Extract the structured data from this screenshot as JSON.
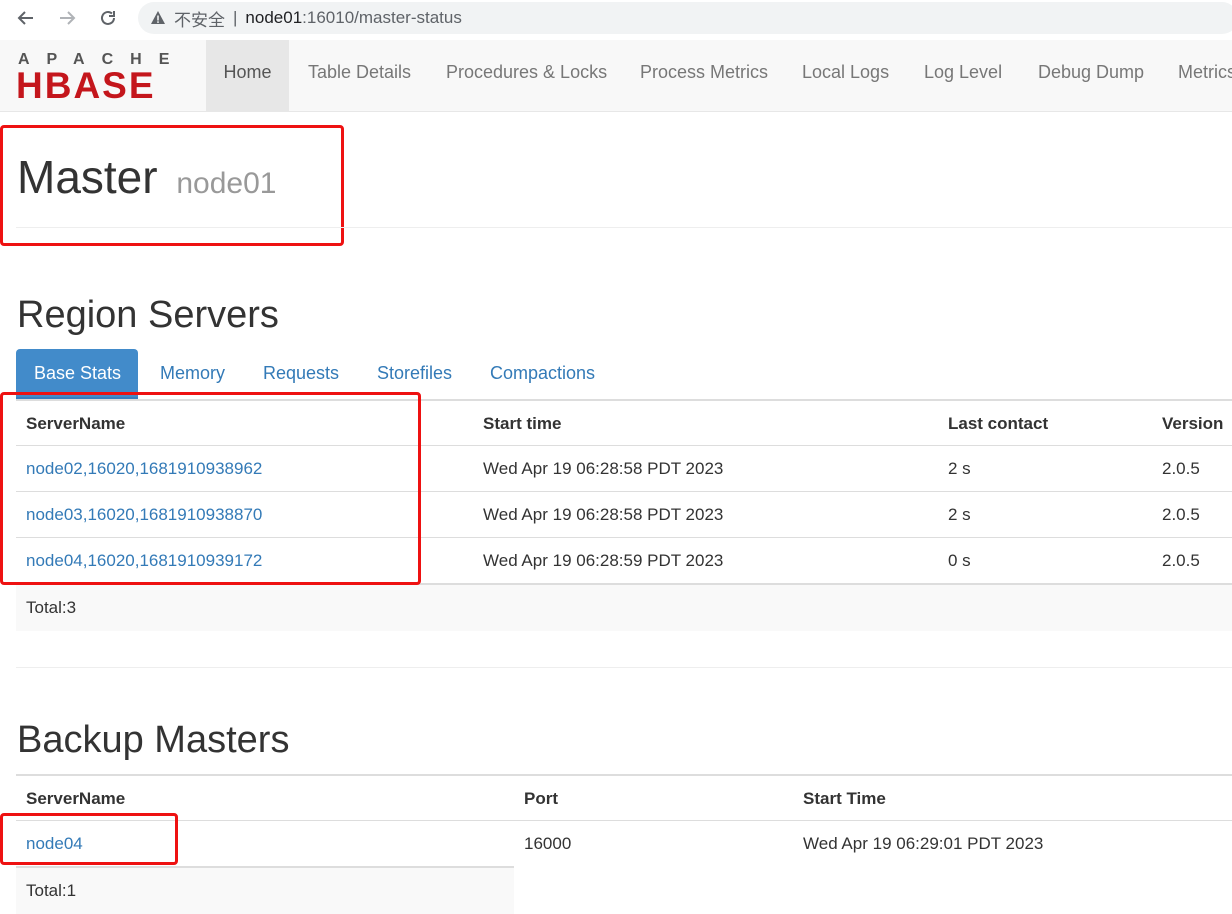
{
  "browser": {
    "back_icon": "arrow-left-icon",
    "forward_icon": "arrow-right-icon",
    "reload_icon": "reload-icon",
    "security_label": "不安全",
    "separator": "|",
    "url_host": "node01",
    "url_path": ":16010/master-status"
  },
  "navbar": {
    "logo_top": "APACHE",
    "logo_main": "HBASE",
    "items": [
      {
        "label": "Home"
      },
      {
        "label": "Table Details"
      },
      {
        "label": "Procedures & Locks"
      },
      {
        "label": "Process Metrics"
      },
      {
        "label": "Local Logs"
      },
      {
        "label": "Log Level"
      },
      {
        "label": "Debug Dump"
      },
      {
        "label": "Metrics"
      }
    ]
  },
  "page": {
    "title": "Master",
    "host": "node01"
  },
  "region_servers": {
    "heading": "Region Servers",
    "tabs": [
      {
        "label": "Base Stats"
      },
      {
        "label": "Memory"
      },
      {
        "label": "Requests"
      },
      {
        "label": "Storefiles"
      },
      {
        "label": "Compactions"
      }
    ],
    "columns": [
      "ServerName",
      "Start time",
      "Last contact",
      "Version"
    ],
    "rows": [
      {
        "server": "node02,16020,1681910938962",
        "start": "Wed Apr 19 06:28:58 PDT 2023",
        "contact": "2 s",
        "version": "2.0.5"
      },
      {
        "server": "node03,16020,1681910938870",
        "start": "Wed Apr 19 06:28:58 PDT 2023",
        "contact": "2 s",
        "version": "2.0.5"
      },
      {
        "server": "node04,16020,1681910939172",
        "start": "Wed Apr 19 06:28:59 PDT 2023",
        "contact": "0 s",
        "version": "2.0.5"
      }
    ],
    "total": "Total:3"
  },
  "backup_masters": {
    "heading": "Backup Masters",
    "columns": [
      "ServerName",
      "Port",
      "Start Time"
    ],
    "rows": [
      {
        "server": "node04",
        "port": "16000",
        "start": "Wed Apr 19 06:29:01 PDT 2023"
      }
    ],
    "total": "Total:1"
  },
  "colors": {
    "annotation_red": "#ee1111",
    "link": "#337ab7",
    "active_tab": "#428bca"
  }
}
